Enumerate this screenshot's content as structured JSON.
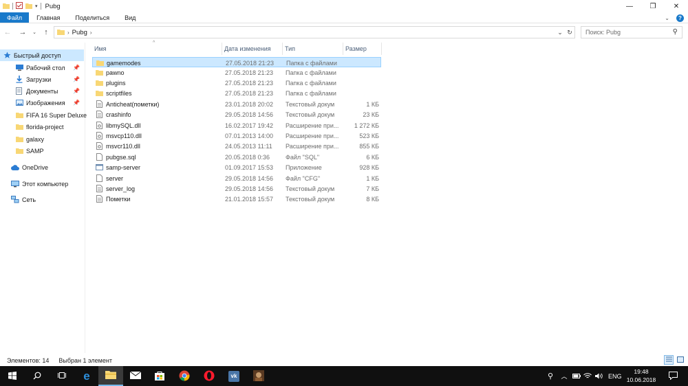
{
  "window": {
    "title": "Pubg",
    "minimize_icon": "minimize-icon",
    "maximize_icon": "restore-icon",
    "close_icon": "close-icon"
  },
  "ribbon": {
    "tabs": [
      "Файл",
      "Главная",
      "Поделиться",
      "Вид"
    ],
    "accent": "#1979ca"
  },
  "address": {
    "path": "Pubg",
    "search_placeholder": "Поиск: Pubg"
  },
  "nav": {
    "items": [
      {
        "label": "Быстрый доступ",
        "icon": "star-icon",
        "pinned": false,
        "selected": true
      },
      {
        "label": "Рабочий стол",
        "icon": "desktop-icon",
        "pinned": true
      },
      {
        "label": "Загрузки",
        "icon": "download-icon",
        "pinned": true
      },
      {
        "label": "Документы",
        "icon": "documents-icon",
        "pinned": true
      },
      {
        "label": "Изображения",
        "icon": "pictures-icon",
        "pinned": true
      },
      {
        "label": "FIFA 16 Super Deluxe",
        "icon": "folder-icon",
        "pinned": false
      },
      {
        "label": "florida-project",
        "icon": "folder-icon",
        "pinned": false
      },
      {
        "label": "galaxy",
        "icon": "folder-icon",
        "pinned": false
      },
      {
        "label": "SAMP",
        "icon": "folder-icon",
        "pinned": false
      },
      {
        "label": "OneDrive",
        "icon": "cloud-icon",
        "pinned": false
      },
      {
        "label": "Этот компьютер",
        "icon": "computer-icon",
        "pinned": false
      },
      {
        "label": "Сеть",
        "icon": "network-icon",
        "pinned": false
      }
    ]
  },
  "columns": {
    "name": "Имя",
    "date": "Дата изменения",
    "type": "Тип",
    "size": "Размер"
  },
  "files": [
    {
      "name": "gamemodes",
      "date": "27.05.2018 21:23",
      "type": "Папка с файлами",
      "size": "",
      "icon": "folder-icon",
      "selected": true
    },
    {
      "name": "pawno",
      "date": "27.05.2018 21:23",
      "type": "Папка с файлами",
      "size": "",
      "icon": "folder-icon"
    },
    {
      "name": "plugins",
      "date": "27.05.2018 21:23",
      "type": "Папка с файлами",
      "size": "",
      "icon": "folder-icon"
    },
    {
      "name": "scriptfiles",
      "date": "27.05.2018 21:23",
      "type": "Папка с файлами",
      "size": "",
      "icon": "folder-icon"
    },
    {
      "name": "Anticheat(пометки)",
      "date": "23.01.2018 20:02",
      "type": "Текстовый докум",
      "size": "1 КБ",
      "icon": "text-file-icon"
    },
    {
      "name": "crashinfo",
      "date": "29.05.2018 14:56",
      "type": "Текстовый докум",
      "size": "23 КБ",
      "icon": "text-file-icon"
    },
    {
      "name": "libmySQL.dll",
      "date": "16.02.2017 19:42",
      "type": "Расширение при...",
      "size": "1 272 КБ",
      "icon": "dll-file-icon"
    },
    {
      "name": "msvcp110.dll",
      "date": "07.01.2013 14:00",
      "type": "Расширение при...",
      "size": "523 КБ",
      "icon": "dll-file-icon"
    },
    {
      "name": "msvcr110.dll",
      "date": "24.05.2013 11:11",
      "type": "Расширение при...",
      "size": "855 КБ",
      "icon": "dll-file-icon"
    },
    {
      "name": "pubgse.sql",
      "date": "20.05.2018 0:36",
      "type": "Файл \"SQL\"",
      "size": "6 КБ",
      "icon": "file-icon"
    },
    {
      "name": "samp-server",
      "date": "01.09.2017 15:53",
      "type": "Приложение",
      "size": "928 КБ",
      "icon": "app-icon"
    },
    {
      "name": "server",
      "date": "29.05.2018 14:56",
      "type": "Файл \"CFG\"",
      "size": "1 КБ",
      "icon": "file-icon"
    },
    {
      "name": "server_log",
      "date": "29.05.2018 14:56",
      "type": "Текстовый докум",
      "size": "7 КБ",
      "icon": "text-file-icon"
    },
    {
      "name": "Пометки",
      "date": "21.01.2018 15:57",
      "type": "Текстовый докум",
      "size": "8 КБ",
      "icon": "text-file-icon"
    }
  ],
  "status": {
    "count": "Элементов: 14",
    "selection": "Выбран 1 элемент"
  },
  "taskbar": {
    "lang": "ENG",
    "time": "19:48",
    "date": "10.06.2018",
    "apps": [
      "start-icon",
      "search-icon",
      "task-view-icon",
      "edge-icon",
      "file-explorer-icon",
      "mail-icon",
      "store-icon",
      "chrome-icon",
      "opera-icon",
      "vk-icon",
      "game-icon"
    ]
  }
}
